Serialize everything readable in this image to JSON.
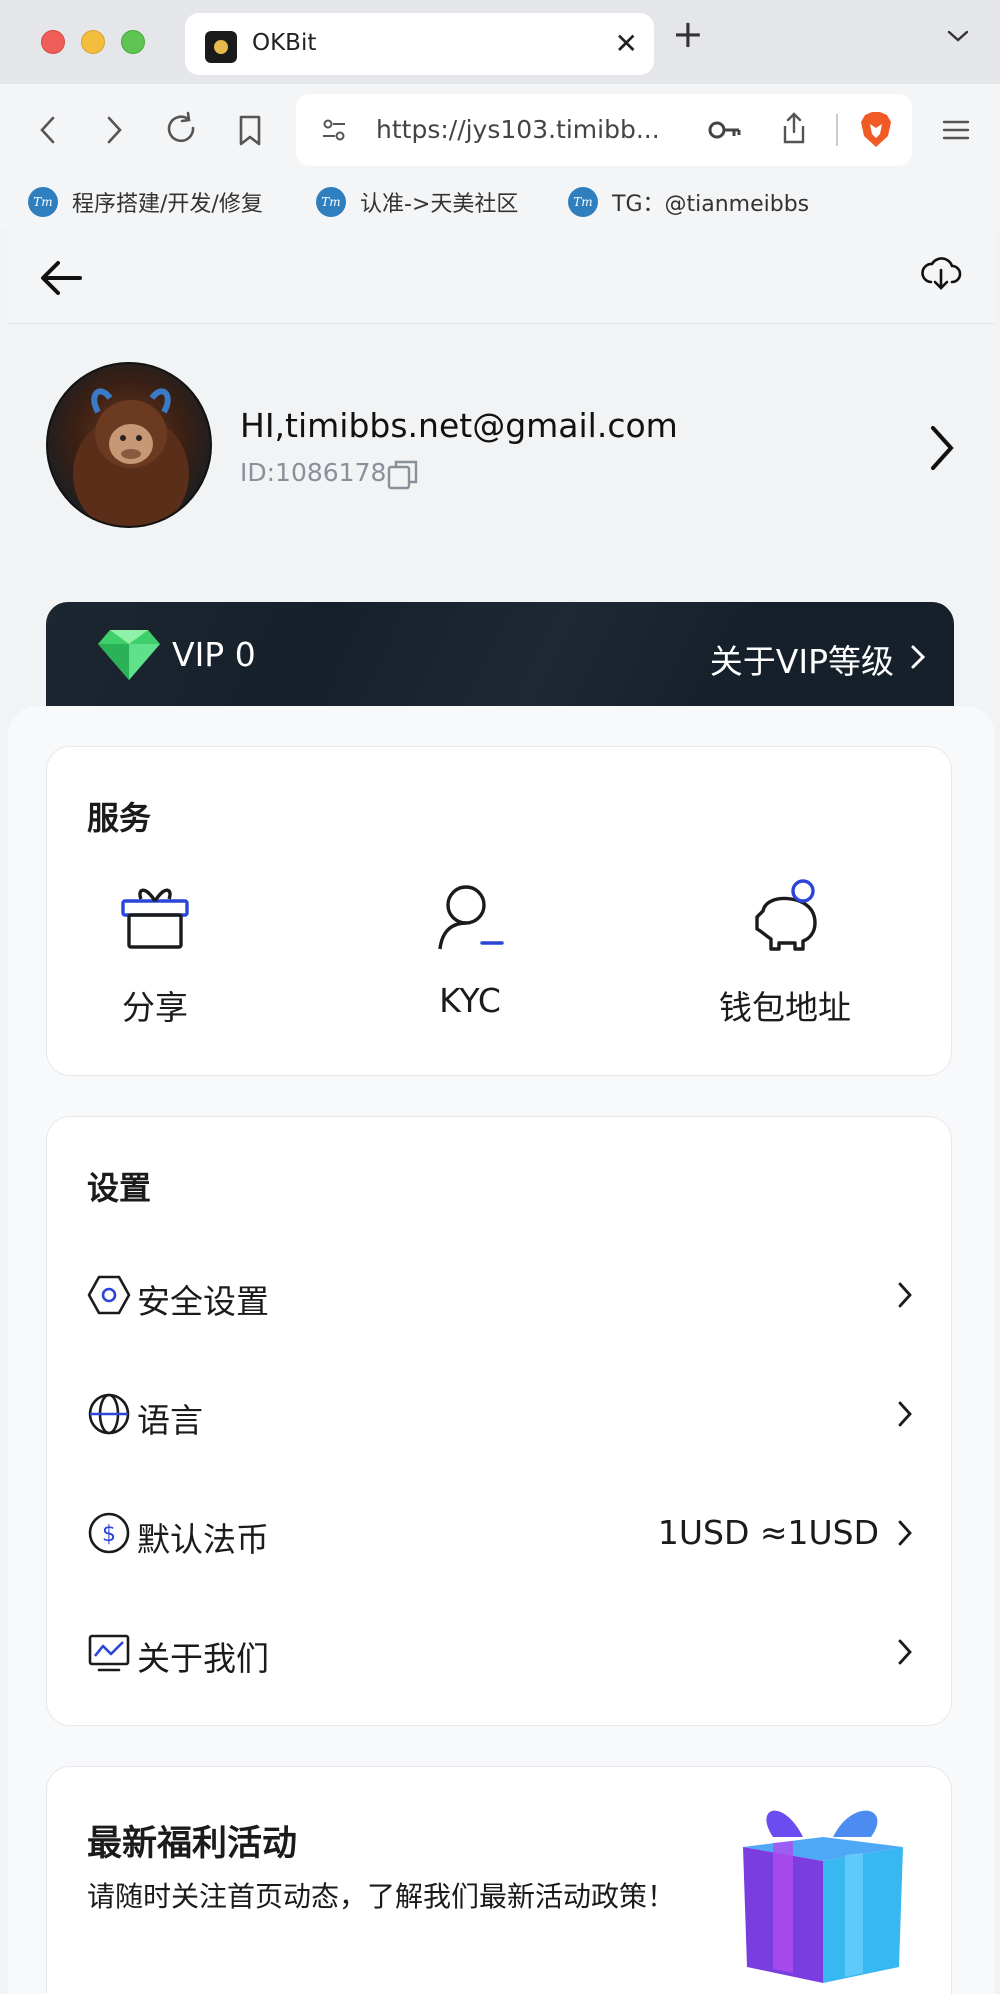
{
  "browser": {
    "tab_title": "OKBit",
    "url": "https://jys103.timibb...",
    "bookmarks": [
      {
        "label": "程序搭建/开发/修复"
      },
      {
        "label": "认准->天美社区"
      },
      {
        "label": "TG：@tianmeibbs"
      }
    ],
    "bookmark_icon_text": "Tm"
  },
  "profile": {
    "greeting": "HI,timibbs.net@gmail.com",
    "uid": "ID:1086178"
  },
  "vip": {
    "level": "VIP 0",
    "link": "关于VIP等级"
  },
  "services": {
    "title": "服务",
    "items": [
      {
        "label": "分享",
        "icon": "gift-icon"
      },
      {
        "label": "KYC",
        "icon": "user-icon"
      },
      {
        "label": "钱包地址",
        "icon": "piggy-bank-icon"
      }
    ]
  },
  "settings": {
    "title": "设置",
    "items": [
      {
        "label": "安全设置",
        "value": "",
        "icon": "shield-hexagon-icon"
      },
      {
        "label": "语言",
        "value": "",
        "icon": "globe-icon"
      },
      {
        "label": "默认法币",
        "value": "1USD ≈1USD",
        "icon": "dollar-icon"
      },
      {
        "label": "关于我们",
        "value": "",
        "icon": "monitor-icon"
      }
    ]
  },
  "promo": {
    "title": "最新福利活动",
    "subtitle": "请随时关注首页动态，了解我们最新活动政策！"
  },
  "colors": {
    "accent": "#2a45d8",
    "vip_bg": "#15202b"
  }
}
